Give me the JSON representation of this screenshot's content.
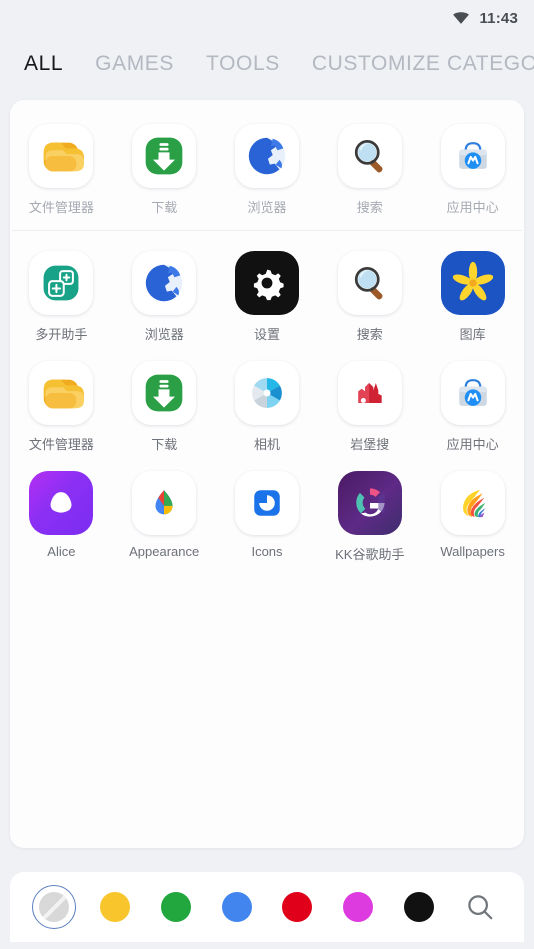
{
  "status_bar": {
    "wifi_icon": "wifi-icon",
    "time": "11:43"
  },
  "tabs": [
    {
      "label": "ALL",
      "active": true
    },
    {
      "label": "GAMES",
      "active": false
    },
    {
      "label": "TOOLS",
      "active": false
    },
    {
      "label": "CUSTOMIZE CATEGO",
      "active": false
    }
  ],
  "recent_row": [
    {
      "label": "文件管理器",
      "icon": "folder-icon",
      "dim": true
    },
    {
      "label": "下载",
      "icon": "download-icon",
      "dim": true
    },
    {
      "label": "浏览器",
      "icon": "globe-icon",
      "dim": true
    },
    {
      "label": "搜索",
      "icon": "magnifier-icon",
      "dim": true
    },
    {
      "label": "应用中心",
      "icon": "appstore-bag-icon",
      "dim": true
    }
  ],
  "app_grid": [
    [
      {
        "label": "多开助手",
        "icon": "multi-window-icon"
      },
      {
        "label": "浏览器",
        "icon": "globe-icon"
      },
      {
        "label": "设置",
        "icon": "gear-icon"
      },
      {
        "label": "搜索",
        "icon": "magnifier-icon"
      },
      {
        "label": "图库",
        "icon": "gallery-flower-icon"
      }
    ],
    [
      {
        "label": "文件管理器",
        "icon": "folder-icon"
      },
      {
        "label": "下载",
        "icon": "download-icon"
      },
      {
        "label": "相机",
        "icon": "camera-shutter-icon"
      },
      {
        "label": "岩堡搜",
        "icon": "castle-icon"
      },
      {
        "label": "应用中心",
        "icon": "appstore-bag-icon"
      }
    ],
    [
      {
        "label": "Alice",
        "icon": "alice-icon"
      },
      {
        "label": "Appearance",
        "icon": "appearance-droplet-icon"
      },
      {
        "label": "Icons",
        "icon": "icons-pack-icon"
      },
      {
        "label": "KK谷歌助手",
        "icon": "google-g-icon"
      },
      {
        "label": "Wallpapers",
        "icon": "wallpapers-icon"
      }
    ]
  ],
  "color_bar": {
    "swatches": [
      {
        "name": "none",
        "color": "#d8d8d8",
        "selected": true
      },
      {
        "name": "yellow",
        "color": "#f9c52c",
        "selected": false
      },
      {
        "name": "green",
        "color": "#22a73e",
        "selected": false
      },
      {
        "name": "blue",
        "color": "#4285ee",
        "selected": false
      },
      {
        "name": "red",
        "color": "#e00019",
        "selected": false
      },
      {
        "name": "magenta",
        "color": "#dd3adf",
        "selected": false
      },
      {
        "name": "black",
        "color": "#111111",
        "selected": false
      }
    ],
    "search_icon": "search-icon"
  },
  "theme": {
    "background": "#eff1f5",
    "card": "#fdfdfe",
    "active_tab": "#15171a",
    "inactive_tab": "#b4b8c0",
    "label": "#6d7178"
  }
}
